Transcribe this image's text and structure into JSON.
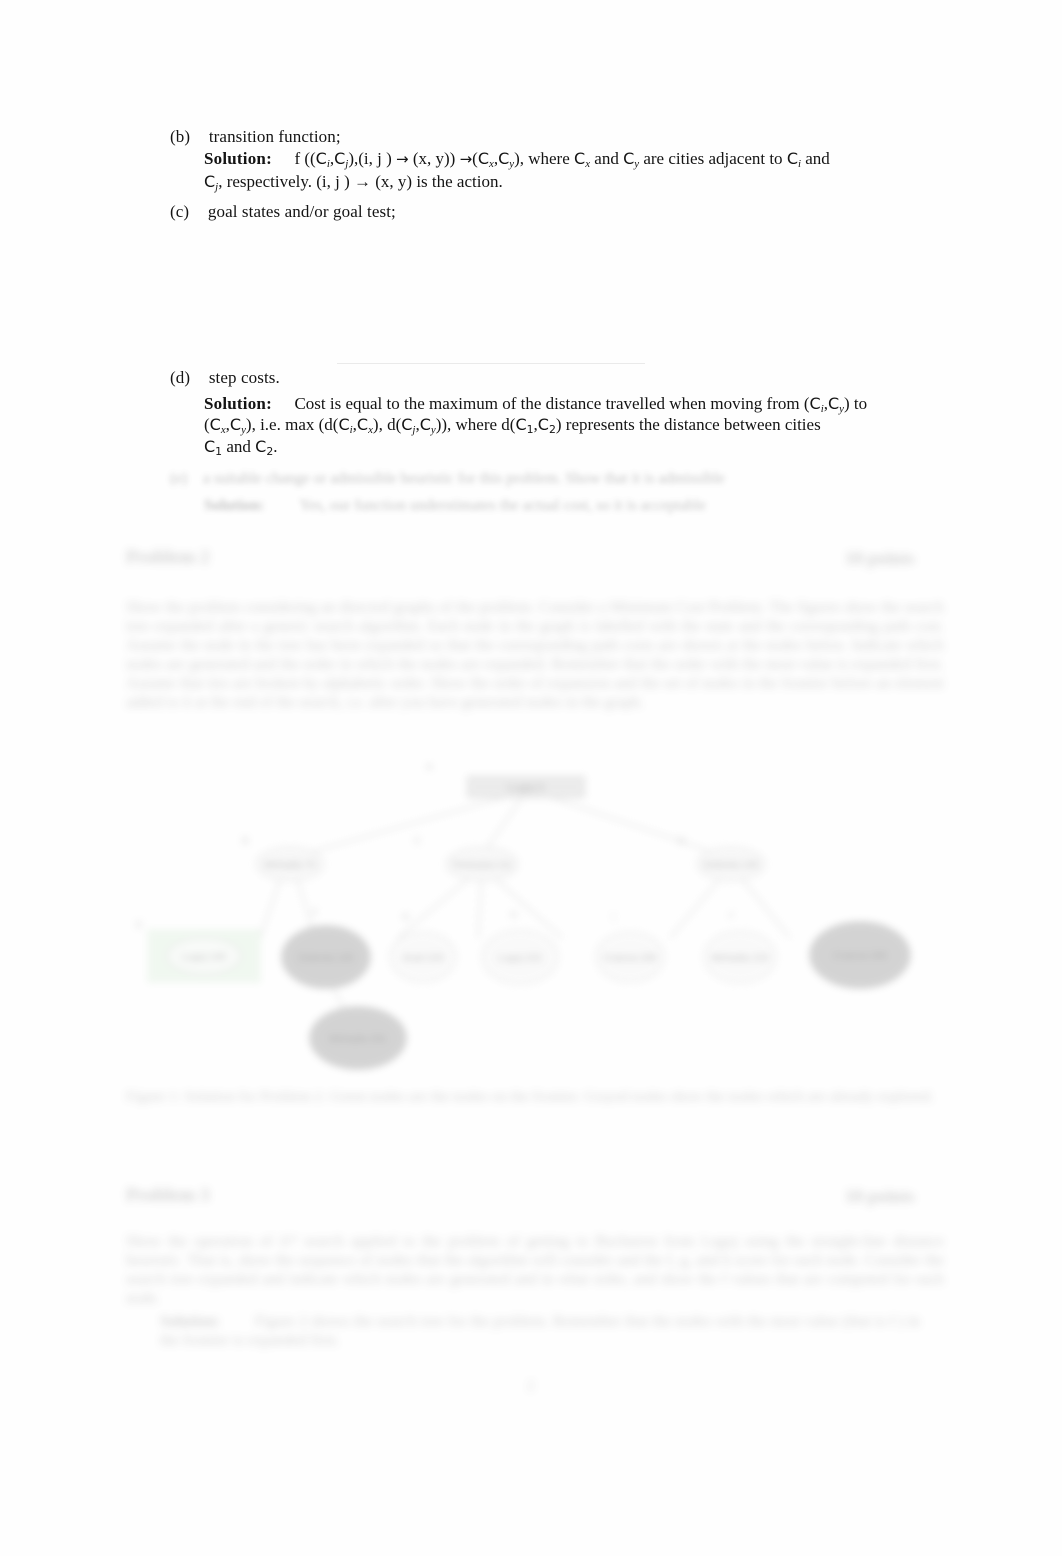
{
  "document": {
    "page_number": "2",
    "accent_highlight": "#dff0df",
    "node_fill": "#9a9a9a",
    "node_stroke": "#7d7d7d",
    "rule_color": "#d9d9d9"
  },
  "items": [
    {
      "marker": "(b)",
      "title": "transition function;",
      "solution_label": "Solution:"
    },
    {
      "marker": "(c)",
      "title": "goal states and/or goal test;"
    },
    {
      "marker": "(d)",
      "title": "step costs.",
      "solution_label": "Solution:"
    }
  ],
  "transition": {
    "line1_a": "f ((",
    "line1_b": "),(i, j ) ",
    "line1_c": " (x, y)) ",
    "line1_d": "(",
    "line1_e": "), where ",
    "line1_f": " and ",
    "line1_g": " are cities adjacent to ",
    "line1_h": " and",
    "line2": ", respectively. (i, j ) → (x, y) is the action."
  },
  "stepcosts": {
    "line1": "Cost is equal to the maximum of the distance travelled when moving from (",
    "line1_end": ") to",
    "line2_a": "), i.e.  max (d(",
    "line2_b": "), d(",
    "line2_c": ")), where d(",
    "line2_d": ") represents the distance between cities",
    "line3_a": " and ",
    "line3_b": "."
  },
  "blurred": {
    "item_e": {
      "marker": "(e)",
      "text": "a suitable change or admissible heuristic for this problem. Show that it is admissible",
      "solution_label": "Solution:",
      "solution_text": "Yes, our function understimates the actual cost, so it is acceptable"
    },
    "problem2": {
      "heading": "Problem 2",
      "points": "10 points",
      "paragraph": "Show the problem considering an directed graphs of the problem. Consider a Minimum Cost Problem. The figures show the search tree expanded after a generic search algorithm. Each node in the graph is labelled with the state and the corresponding path cost. Assume the node in the tree has been expanded so that the corresponding path costs are shown at the nodes below. Indicate which nodes are generated and the order in which the nodes are expanded. Remember that the order with the most value is expanded first. Assume that ties are broken by alphabetic order. Show the order of expansion and the set of nodes in the frontier before an element added to it at the end of the search, i.e. after you have generated nodes in the graph.",
      "caption": "Figure 1: Solution for Problem 2. Green nodes are the nodes on the frontier. Grayed nodes show the nodes which are already explored."
    },
    "problem3": {
      "heading": "Problem 3",
      "points": "10 points",
      "paragraph": "Show the operation of A* search applied to the problem of getting to Bucharest from Lugoj using the straight-line distance heuristic. That is, show the sequence of nodes that the algorithm will consider and the f, g, and h score for each node. Consider the search tree expanded and indicate which nodes are generated and in what order, and show the f values that are computed for each node.",
      "solution_label": "Solution:",
      "solution_text": "Figure 2 shows the search tree for the problem. Remember that the nodes with the most value (that is f ) in the frontier is expanded first."
    }
  },
  "tree": {
    "root_label": "Lugoj 0",
    "root_tag": "A",
    "level2": [
      {
        "label": "Mehadia 70",
        "tag": "B"
      },
      {
        "label": "Timisoara 111",
        "tag": "C"
      },
      {
        "label": "Dobreta 145",
        "tag": "D"
      }
    ],
    "level3": [
      {
        "label": "Lugoj 140",
        "tag": "E",
        "state": "frontier"
      },
      {
        "label": "Dobreta 145",
        "tag": "F",
        "state": "explored"
      },
      {
        "label": "Arad 229",
        "tag": "G",
        "state": "open"
      },
      {
        "label": "Lugoj 222",
        "tag": "H",
        "state": "open"
      },
      {
        "label": "Craiova 265",
        "tag": "I",
        "state": "open"
      },
      {
        "label": "Mehadia 215",
        "tag": "J",
        "state": "open"
      },
      {
        "label": "Craiova 265",
        "tag": "K",
        "state": "explored"
      }
    ],
    "level4": [
      {
        "label": "Mehadia 291",
        "tag": "L",
        "state": "explored"
      }
    ]
  }
}
